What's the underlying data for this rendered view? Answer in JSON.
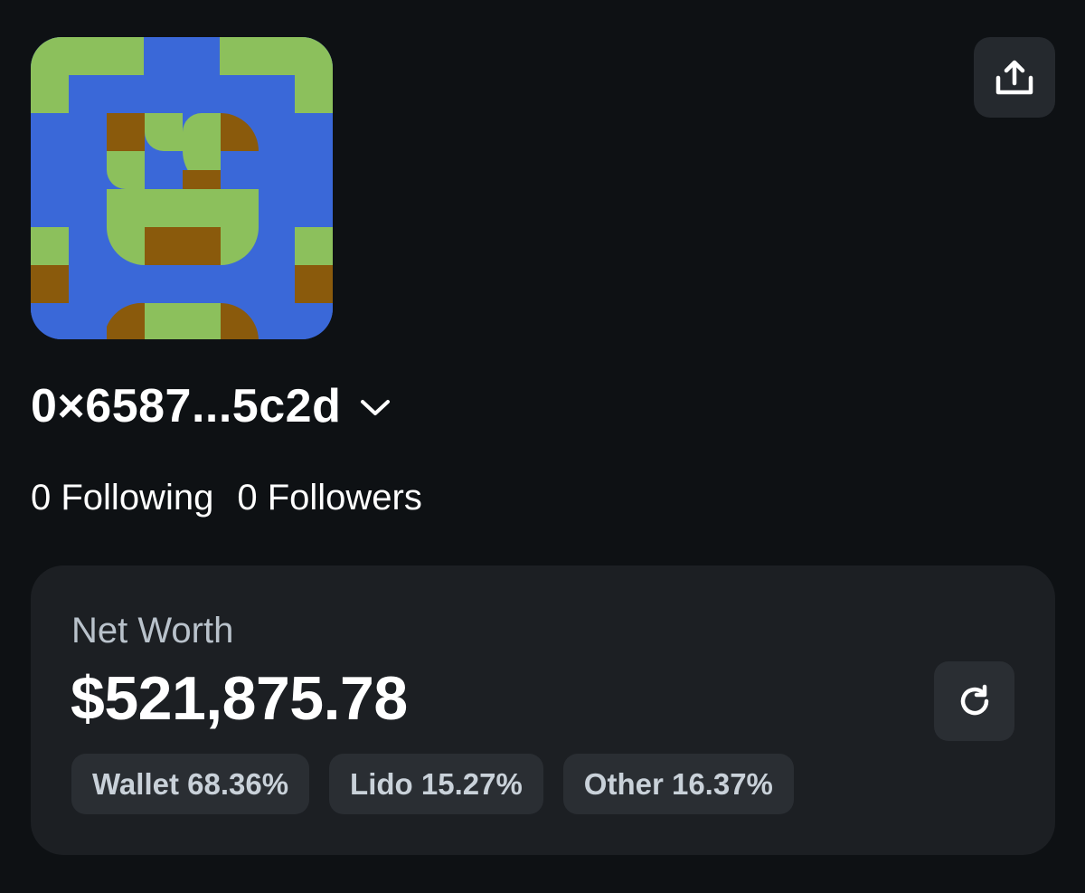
{
  "profile": {
    "avatar_icon": "pixel-identicon-avatar",
    "address": "0×6587...5c2d",
    "following": "0 Following",
    "followers": "0 Followers"
  },
  "icons": {
    "share": "share-upload-icon",
    "chevron": "chevron-down-icon",
    "refresh": "refresh-icon"
  },
  "net_worth": {
    "label": "Net Worth",
    "value": "$521,875.78",
    "breakdown": [
      {
        "label": "Wallet 68.36%"
      },
      {
        "label": "Lido 15.27%"
      },
      {
        "label": "Other 16.37%"
      }
    ]
  },
  "colors": {
    "background": "#0e1114",
    "card": "#1c1f23",
    "chip": "#2a2e33",
    "avatar_blue": "#3a68d8",
    "avatar_green": "#8cc05c",
    "avatar_brown": "#8a5a0c"
  }
}
